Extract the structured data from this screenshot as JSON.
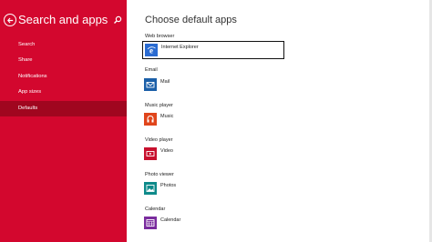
{
  "sidebar": {
    "title": "Search and apps",
    "items": [
      {
        "label": "Search"
      },
      {
        "label": "Share"
      },
      {
        "label": "Notifications"
      },
      {
        "label": "App sizes"
      },
      {
        "label": "Defaults"
      }
    ],
    "active_index": 4
  },
  "main": {
    "title": "Choose default apps",
    "sections": [
      {
        "label": "Web browser",
        "app": "Internet Explorer",
        "icon": "internet-explorer-icon",
        "icon_color": "#2a6bd1"
      },
      {
        "label": "Email",
        "app": "Mail",
        "icon": "mail-icon",
        "icon_color": "#1b5fa8"
      },
      {
        "label": "Music player",
        "app": "Music",
        "icon": "headphones-icon",
        "icon_color": "#e0451b"
      },
      {
        "label": "Video player",
        "app": "Video",
        "icon": "video-icon",
        "icon_color": "#c8102e"
      },
      {
        "label": "Photo viewer",
        "app": "Photos",
        "icon": "photos-icon",
        "icon_color": "#0e8a8a"
      },
      {
        "label": "Calendar",
        "app": "Calendar",
        "icon": "calendar-icon",
        "icon_color": "#7a2c9e"
      }
    ]
  },
  "colors": {
    "sidebar_bg": "#d3072e",
    "sidebar_active": "#a0061f"
  }
}
